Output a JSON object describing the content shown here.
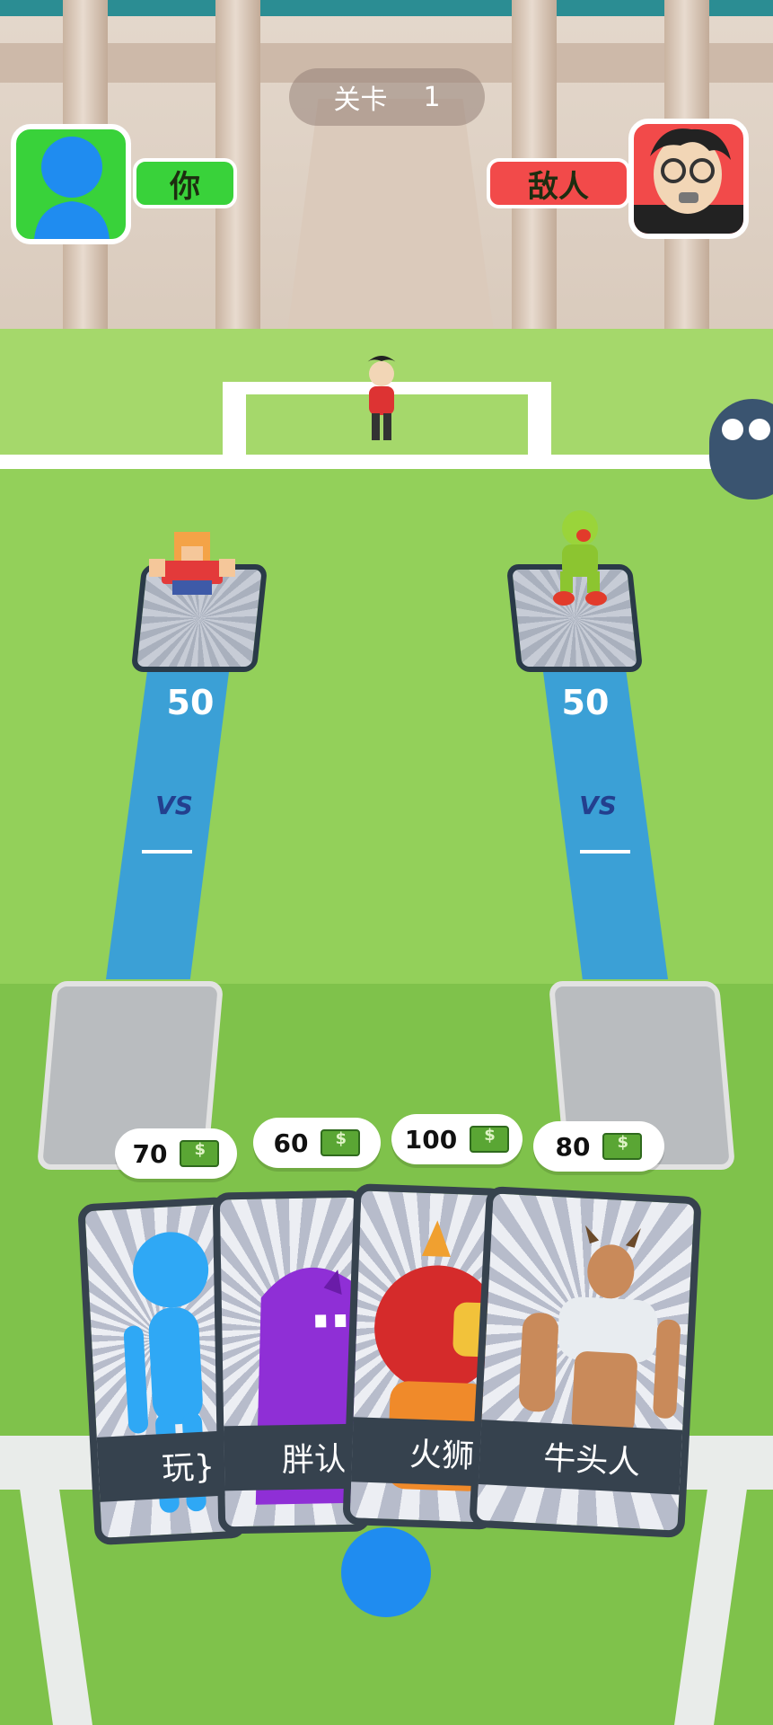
{
  "level": {
    "label": "关卡",
    "number": "1"
  },
  "player": {
    "name": "你",
    "avatar_icon": "blue-stickman-icon",
    "color": "#39d23a"
  },
  "enemy": {
    "name": "敌人",
    "avatar_icon": "old-man-glasses-icon",
    "color": "#f24a4a"
  },
  "lanes": [
    {
      "power": "50",
      "vs": "VS",
      "unit": "blocky-hero-icon"
    },
    {
      "power": "50",
      "vs": "VS",
      "unit": "yellow-duck-monster-icon"
    }
  ],
  "prices": [
    "70",
    "60",
    "100",
    "80"
  ],
  "cards": [
    {
      "label": "玩家",
      "visible_label": "玩}",
      "icon": "blue-stickman-icon"
    },
    {
      "label": "胖",
      "visible_label": "胖认",
      "icon": "purple-blob-monster-icon"
    },
    {
      "label": "火狮",
      "visible_label": "火狮",
      "icon": "fire-lion-icon"
    },
    {
      "label": "牛头人",
      "visible_label": "牛头人",
      "icon": "minotaur-icon"
    }
  ]
}
